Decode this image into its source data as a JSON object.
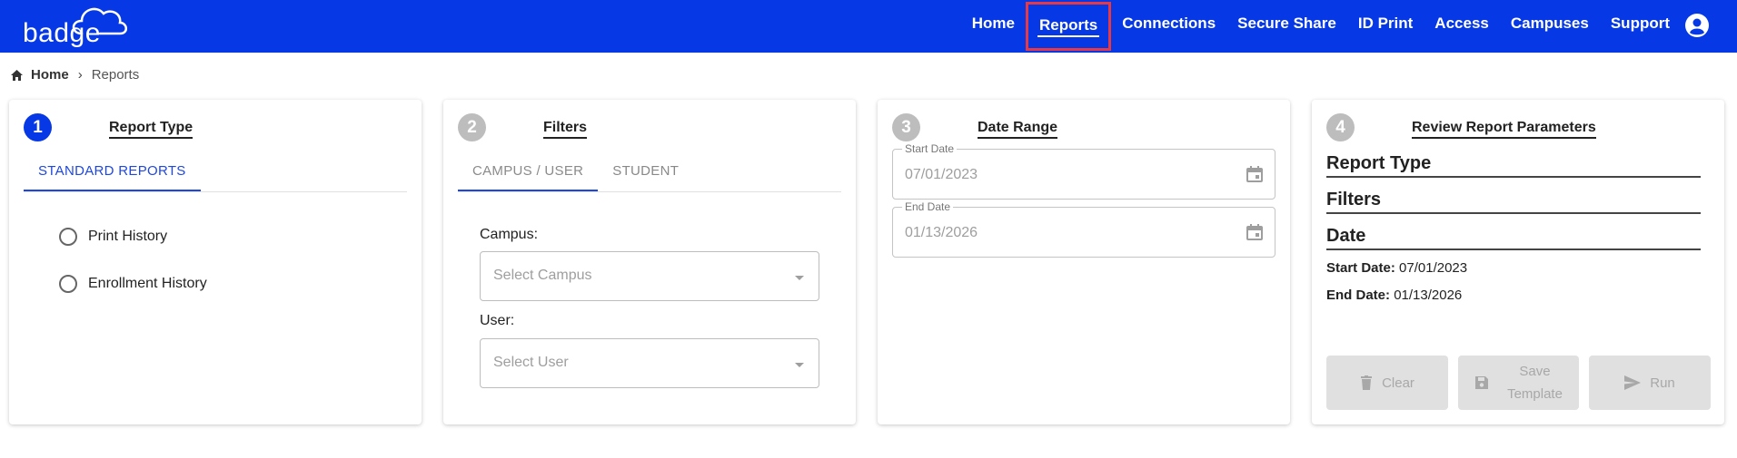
{
  "header": {
    "logo_text": "badge",
    "nav": [
      "Home",
      "Reports",
      "Connections",
      "Secure Share",
      "ID Print",
      "Access",
      "Campuses",
      "Support"
    ],
    "active_nav": "Reports",
    "accent": "#0638e6",
    "highlight": "#e53946"
  },
  "breadcrumb": {
    "home": "Home",
    "current": "Reports"
  },
  "card1": {
    "step": "1",
    "title": "Report Type",
    "tab": "STANDARD REPORTS",
    "options": [
      "Print History",
      "Enrollment History"
    ]
  },
  "card2": {
    "step": "2",
    "title": "Filters",
    "tabs": [
      "CAMPUS / USER",
      "STUDENT"
    ],
    "campus_label": "Campus:",
    "campus_placeholder": "Select Campus",
    "user_label": "User:",
    "user_placeholder": "Select User"
  },
  "card3": {
    "step": "3",
    "title": "Date Range",
    "start_label": "Start Date",
    "start_value": "07/01/2023",
    "end_label": "End Date",
    "end_value": "01/13/2026"
  },
  "card4": {
    "step": "4",
    "title": "Review Report Parameters",
    "sections": [
      "Report Type",
      "Filters",
      "Date"
    ],
    "start_label": "Start Date:",
    "start_value": "07/01/2023",
    "end_label": "End Date:",
    "end_value": "01/13/2026",
    "buttons": {
      "clear": "Clear",
      "save_1": "Save",
      "save_2": "Template",
      "run": "Run"
    }
  }
}
